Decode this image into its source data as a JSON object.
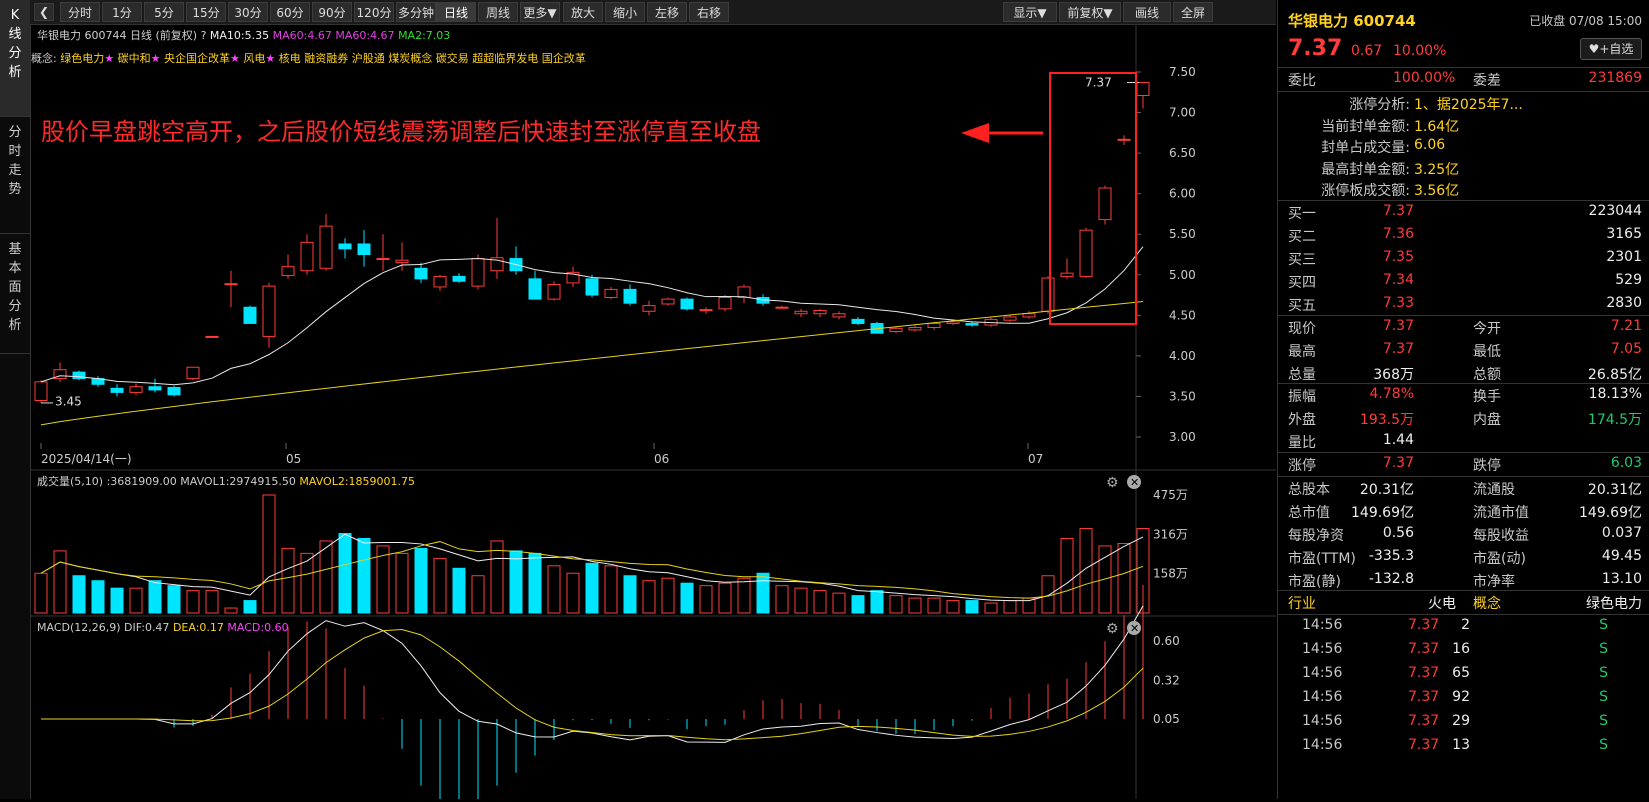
{
  "left_tabs": [
    {
      "label": "K线分析",
      "chars": [
        "K",
        "线",
        "分",
        "析"
      ]
    },
    {
      "label": "分时走势",
      "chars": [
        "分",
        "时",
        "走",
        "势"
      ]
    },
    {
      "label": "基本面分析",
      "chars": [
        "基",
        "本",
        "面",
        "分",
        "析"
      ]
    }
  ],
  "toolbar": {
    "periods": [
      "分时",
      "1分",
      "5分",
      "15分",
      "30分",
      "60分",
      "90分",
      "120分",
      "多分钟",
      "日线",
      "周线",
      "更多▼"
    ],
    "actions": [
      "放大",
      "缩小",
      "左移",
      "右移"
    ],
    "right": [
      "显示▼",
      "前复权▼",
      "画线",
      "全屏"
    ]
  },
  "chart": {
    "info": {
      "name": "华银电力 600744 日线",
      "adjust": "(前复权)",
      "help": "?",
      "ma10": "MA10:5.35",
      "ma60a": "MA60:4.67",
      "ma60b": "MA60:4.67",
      "ma2": "MA2:7.03"
    },
    "concepts_label": "概念:",
    "concepts": [
      {
        "text": "绿色电力",
        "star": true
      },
      {
        "text": "碳中和",
        "star": true
      },
      {
        "text": "央企国企改革",
        "star": true
      },
      {
        "text": "风电",
        "star": true
      },
      {
        "text": "核电",
        "star": false
      },
      {
        "text": "融资融券",
        "star": false
      },
      {
        "text": "沪股通",
        "star": false
      },
      {
        "text": "煤炭概念",
        "star": false
      },
      {
        "text": "碳交易",
        "star": false
      },
      {
        "text": "超超临界发电",
        "star": false
      },
      {
        "text": "国企改革",
        "star": false
      }
    ],
    "annotation": "股价早盘跳空高开，之后股价短线震荡调整后快速封至涨停直至收盘",
    "price_axis": [
      "7.50",
      "7.00",
      "6.50",
      "6.00",
      "5.50",
      "5.00",
      "4.50",
      "4.00",
      "3.50",
      "3.00"
    ],
    "date_labels": [
      "2025/04/14(一)",
      "05",
      "06",
      "07"
    ],
    "low_mark": "3.45",
    "high_mark": "7.37",
    "volume": {
      "title": "成交量(5,10)",
      "vol": ":3681909.00",
      "mavol1": "MAVOL1:2974915.50",
      "mavol2": "MAVOL2:1859001.75",
      "axis": [
        "475万",
        "316万",
        "158万"
      ]
    },
    "macd": {
      "title": "MACD(12,26,9)",
      "dif": "DIF:0.47",
      "dea": "DEA:0.17",
      "macd": "MACD:0.60",
      "axis": [
        "0.60",
        "0.32",
        "0.05"
      ]
    }
  },
  "chart_data": {
    "type": "candlestick",
    "ylim": [
      3.0,
      7.5
    ],
    "candles": [
      [
        3.45,
        3.68,
        3.42,
        3.7
      ],
      [
        3.72,
        3.83,
        3.68,
        3.92
      ],
      [
        3.8,
        3.72,
        3.7,
        3.82
      ],
      [
        3.72,
        3.65,
        3.62,
        3.75
      ],
      [
        3.6,
        3.55,
        3.5,
        3.65
      ],
      [
        3.55,
        3.62,
        3.52,
        3.66
      ],
      [
        3.62,
        3.58,
        3.55,
        3.72
      ],
      [
        3.61,
        3.52,
        3.5,
        3.63
      ],
      [
        3.72,
        3.86,
        3.7,
        3.86
      ],
      [
        4.24,
        4.24,
        4.24,
        4.24
      ],
      [
        4.89,
        4.89,
        4.6,
        5.05
      ],
      [
        4.6,
        4.4,
        4.4,
        4.62
      ],
      [
        4.24,
        4.86,
        4.1,
        4.9
      ],
      [
        4.99,
        5.1,
        4.95,
        5.25
      ],
      [
        5.05,
        5.4,
        5.0,
        5.5
      ],
      [
        5.08,
        5.6,
        5.05,
        5.75
      ],
      [
        5.38,
        5.32,
        5.2,
        5.45
      ],
      [
        5.38,
        5.25,
        5.1,
        5.55
      ],
      [
        5.2,
        5.2,
        5.05,
        5.5
      ],
      [
        5.15,
        5.18,
        5.05,
        5.4
      ],
      [
        5.08,
        4.95,
        4.9,
        5.15
      ],
      [
        4.85,
        4.98,
        4.8,
        5.0
      ],
      [
        4.98,
        4.92,
        4.9,
        5.02
      ],
      [
        4.86,
        5.2,
        4.82,
        5.25
      ],
      [
        5.05,
        5.21,
        4.95,
        5.7
      ],
      [
        5.2,
        5.05,
        5.0,
        5.35
      ],
      [
        4.95,
        4.7,
        4.7,
        5.05
      ],
      [
        4.7,
        4.88,
        4.68,
        4.92
      ],
      [
        4.9,
        5.03,
        4.85,
        5.1
      ],
      [
        4.95,
        4.75,
        4.72,
        5.0
      ],
      [
        4.72,
        4.82,
        4.7,
        4.85
      ],
      [
        4.82,
        4.65,
        4.62,
        4.88
      ],
      [
        4.55,
        4.62,
        4.5,
        4.68
      ],
      [
        4.64,
        4.7,
        4.62,
        4.72
      ],
      [
        4.7,
        4.58,
        4.56,
        4.72
      ],
      [
        4.57,
        4.57,
        4.52,
        4.6
      ],
      [
        4.58,
        4.72,
        4.55,
        4.75
      ],
      [
        4.72,
        4.85,
        4.65,
        4.88
      ],
      [
        4.72,
        4.65,
        4.62,
        4.76
      ],
      [
        4.6,
        4.6,
        4.58,
        4.62
      ],
      [
        4.52,
        4.55,
        4.48,
        4.58
      ],
      [
        4.52,
        4.56,
        4.48,
        4.58
      ],
      [
        4.48,
        4.52,
        4.45,
        4.55
      ],
      [
        4.45,
        4.4,
        4.38,
        4.48
      ],
      [
        4.4,
        4.28,
        4.28,
        4.42
      ],
      [
        4.3,
        4.34,
        4.28,
        4.36
      ],
      [
        4.32,
        4.35,
        4.3,
        4.38
      ],
      [
        4.35,
        4.4,
        4.32,
        4.42
      ],
      [
        4.4,
        4.42,
        4.38,
        4.45
      ],
      [
        4.4,
        4.38,
        4.36,
        4.43
      ],
      [
        4.38,
        4.45,
        4.36,
        4.47
      ],
      [
        4.44,
        4.48,
        4.42,
        4.5
      ],
      [
        4.48,
        4.52,
        4.46,
        4.55
      ],
      [
        4.55,
        4.96,
        4.52,
        4.98
      ],
      [
        4.98,
        5.02,
        4.95,
        5.2
      ],
      [
        4.98,
        5.55,
        4.96,
        5.58
      ],
      [
        5.68,
        6.07,
        5.62,
        6.1
      ],
      [
        6.67,
        6.67,
        6.6,
        6.72
      ],
      [
        7.21,
        7.37,
        7.05,
        7.37
      ]
    ],
    "volumes": [
      "…59 bars omitted here for brevity in tag; see script"
    ],
    "title": "华银电力 600744 日线"
  },
  "right": {
    "stock_name": "华银电力 600744",
    "status": "已收盘 07/08 15:00",
    "price": "7.37",
    "change": "0.67",
    "pct": "10.00%",
    "fav": "+自选",
    "weibi_label": "委比",
    "weibi": "100.00%",
    "weicha_label": "委差",
    "weicha": "231869",
    "limit_analysis": [
      {
        "label": "涨停分析:",
        "value": "1、据2025年7..."
      },
      {
        "label": "当前封单金额:",
        "value": "1.64亿"
      },
      {
        "label": "封单占成交量:",
        "value": "6.06"
      },
      {
        "label": "最高封单金额:",
        "value": "3.25亿"
      },
      {
        "label": "涨停板成交额:",
        "value": "3.56亿"
      }
    ],
    "bids": [
      {
        "label": "买一",
        "price": "7.37",
        "vol": "223044"
      },
      {
        "label": "买二",
        "price": "7.36",
        "vol": "3165"
      },
      {
        "label": "买三",
        "price": "7.35",
        "vol": "2301"
      },
      {
        "label": "买四",
        "price": "7.34",
        "vol": "529"
      },
      {
        "label": "买五",
        "price": "7.33",
        "vol": "2830"
      }
    ],
    "quote": [
      [
        {
          "l": "现价",
          "v": "7.37",
          "c": "red"
        },
        {
          "l": "今开",
          "v": "7.21",
          "c": "red"
        }
      ],
      [
        {
          "l": "最高",
          "v": "7.37",
          "c": "red"
        },
        {
          "l": "最低",
          "v": "7.05",
          "c": "red"
        }
      ],
      [
        {
          "l": "总量",
          "v": "368万",
          "c": "white"
        },
        {
          "l": "总额",
          "v": "26.85亿",
          "c": "white"
        }
      ]
    ],
    "stats": [
      [
        {
          "l": "振幅",
          "v": "4.78%",
          "c": "red"
        },
        {
          "l": "换手",
          "v": "18.13%",
          "c": "white"
        }
      ],
      [
        {
          "l": "外盘",
          "v": "193.5万",
          "c": "red"
        },
        {
          "l": "内盘",
          "v": "174.5万",
          "c": "green"
        }
      ],
      [
        {
          "l": "量比",
          "v": "1.44",
          "c": "white"
        },
        {
          "l": "",
          "v": "",
          "c": "white"
        }
      ]
    ],
    "limits": [
      {
        "l": "涨停",
        "v": "7.37",
        "c": "red"
      },
      {
        "l": "跌停",
        "v": "6.03",
        "c": "green"
      }
    ],
    "fundamentals": [
      [
        {
          "l": "总股本",
          "v": "20.31亿"
        },
        {
          "l": "流通股",
          "v": "20.31亿"
        }
      ],
      [
        {
          "l": "总市值",
          "v": "149.69亿"
        },
        {
          "l": "流通市值",
          "v": "149.69亿"
        }
      ],
      [
        {
          "l": "每股净资",
          "v": "0.56"
        },
        {
          "l": "每股收益",
          "v": "0.037"
        }
      ],
      [
        {
          "l": "市盈(TTM)",
          "v": "-335.3"
        },
        {
          "l": "市盈(动)",
          "v": "49.45"
        }
      ],
      [
        {
          "l": "市盈(静)",
          "v": "-132.8"
        },
        {
          "l": "市净率",
          "v": "13.10"
        }
      ]
    ],
    "industry": {
      "l1": "行业",
      "v1": "火电",
      "l2": "概念",
      "v2": "绿色电力"
    },
    "ticks": [
      {
        "t": "14:56",
        "p": "7.37",
        "v": "2",
        "s": "S"
      },
      {
        "t": "14:56",
        "p": "7.37",
        "v": "16",
        "s": "S"
      },
      {
        "t": "14:56",
        "p": "7.37",
        "v": "65",
        "s": "S"
      },
      {
        "t": "14:56",
        "p": "7.37",
        "v": "92",
        "s": "S"
      },
      {
        "t": "14:56",
        "p": "7.37",
        "v": "29",
        "s": "S"
      },
      {
        "t": "14:56",
        "p": "7.37",
        "v": "13",
        "s": "S"
      }
    ],
    "colors": {
      "up": "#ff3b3b",
      "down": "#00e5ff",
      "ma_white": "#e8e8e8",
      "ma_yellow": "#e6d21a",
      "accent": "#ffd21f"
    }
  }
}
